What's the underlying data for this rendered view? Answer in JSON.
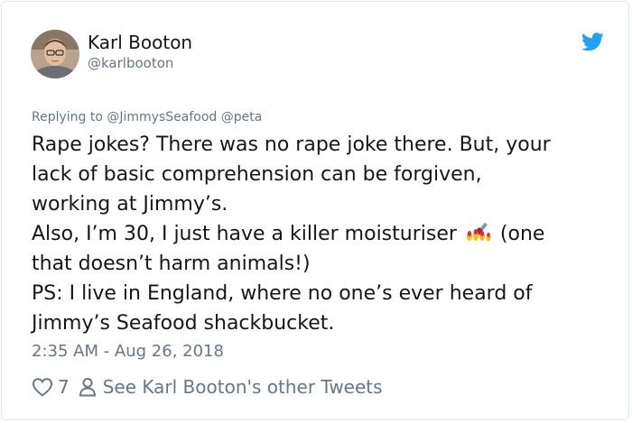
{
  "user": {
    "display_name": "Karl Booton",
    "handle": "@karlbooton",
    "avatar_icon": "profile-photo"
  },
  "brand": {
    "icon": "twitter-bird-icon",
    "color": "#1da1f2"
  },
  "reply": {
    "label": "Replying to",
    "mentions": "@JimmysSeafood @peta"
  },
  "tweet": {
    "lines": [
      "Rape jokes? There was no rape joke there. But, your",
      "lack of basic comprehension can be forgiven,",
      "working at Jimmy’s.",
      "Also, I’m 30, I just have a killer moisturiser",
      "(one",
      "that doesn’t harm animals!)",
      "PS: I live in England, where no one’s ever heard of",
      "Jimmy’s Seafood shackbucket."
    ],
    "emoji": "nail-polish-emoji"
  },
  "meta": {
    "timestamp": "2:35 AM - Aug 26, 2018"
  },
  "actions": {
    "like_count": "7",
    "other_tweets_label": "See Karl Booton's other Tweets"
  },
  "colors": {
    "text": "#14171a",
    "secondary": "#657786",
    "border": "#e1e8ed"
  }
}
